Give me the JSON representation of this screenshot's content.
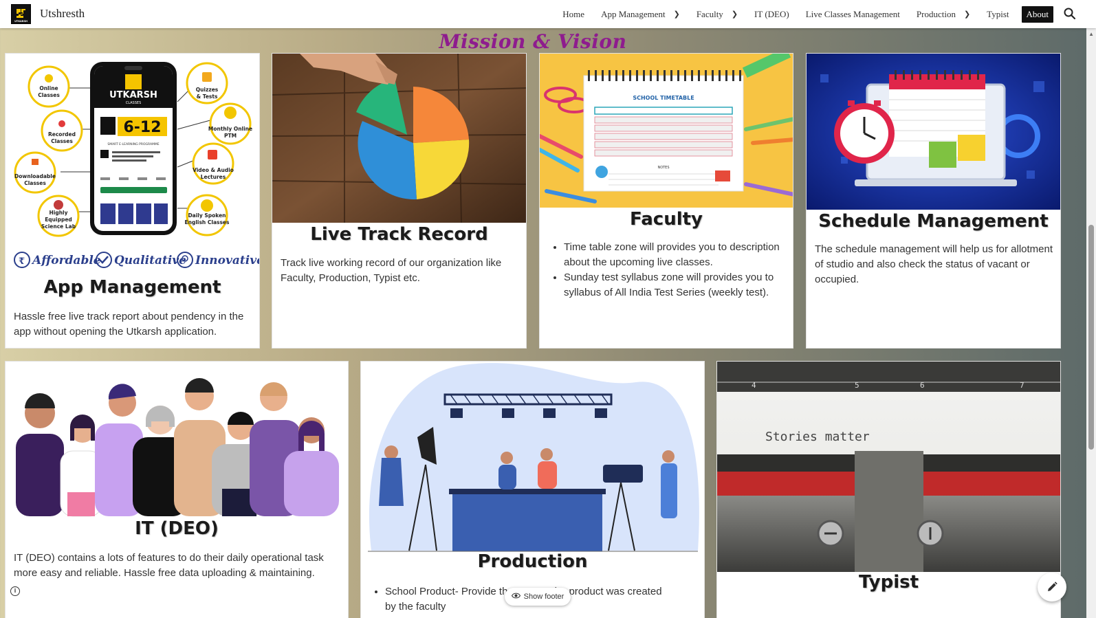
{
  "site": {
    "title": "Utshresth",
    "logo_text": "UTKARSH"
  },
  "nav": {
    "items": [
      {
        "label": "Home",
        "dropdown": false
      },
      {
        "label": "App Management",
        "dropdown": true
      },
      {
        "label": "Faculty",
        "dropdown": true
      },
      {
        "label": "IT (DEO)",
        "dropdown": false
      },
      {
        "label": "Live Classes Management",
        "dropdown": false
      },
      {
        "label": "Production",
        "dropdown": true
      },
      {
        "label": "Typist",
        "dropdown": false
      },
      {
        "label": "About",
        "dropdown": false,
        "active": true
      }
    ],
    "search_icon": "search-icon"
  },
  "section_title": "Mission & Vision",
  "cards": {
    "app_management": {
      "title": "App Management",
      "text": "Hassle free live track report about pendency in the app without opening the Utkarsh application.",
      "image": {
        "features": [
          "Online Classes",
          "Recorded Classes",
          "Downloadable Classes",
          "Highly Equipped Science Lab",
          "Quizzes & Tests",
          "Monthly Online PTM",
          "Video & Audio Lectures",
          "Daily Spoken English Classes"
        ],
        "brand": "UTKARSH",
        "brand_sub": "CLASSES",
        "grade": "6-12",
        "program": "SMART E-LEARNING PROGRAMME",
        "tags": [
          "Affordable",
          "Qualitative",
          "Innovative"
        ]
      }
    },
    "live_track": {
      "title": "Live Track Record",
      "text": "Track live working record of our organization like Faculty, Production, Typist etc."
    },
    "faculty": {
      "title": "Faculty",
      "image_label": "SCHOOL TIMETABLE",
      "notes_label": "NOTES",
      "bullets": [
        "Time table zone will provides you to description about the upcoming live classes.",
        "Sunday test syllabus zone will provides you to syllabus of All India Test Series (weekly test)."
      ]
    },
    "schedule": {
      "title": "Schedule Management",
      "text": "The schedule management will help us for allotment of studio and also check the status of vacant or occupied."
    },
    "it_deo": {
      "title": "IT (DEO)",
      "text": "IT (DEO) contains a lots of features to do their daily operational task more easy and reliable. Hassle free data uploading & maintaining."
    },
    "production": {
      "title": "Production",
      "bullet_visible_start": "School Product- Provide th",
      "bullet_visible_end": "the product was created",
      "bullet_line2": "by the faculty"
    },
    "typist": {
      "title": "Typist",
      "image_text": "Stories matter"
    }
  },
  "footer": {
    "show_footer_label": "Show footer"
  },
  "colors": {
    "title_purple": "#8e1c8e",
    "nav_active_bg": "#111111"
  }
}
